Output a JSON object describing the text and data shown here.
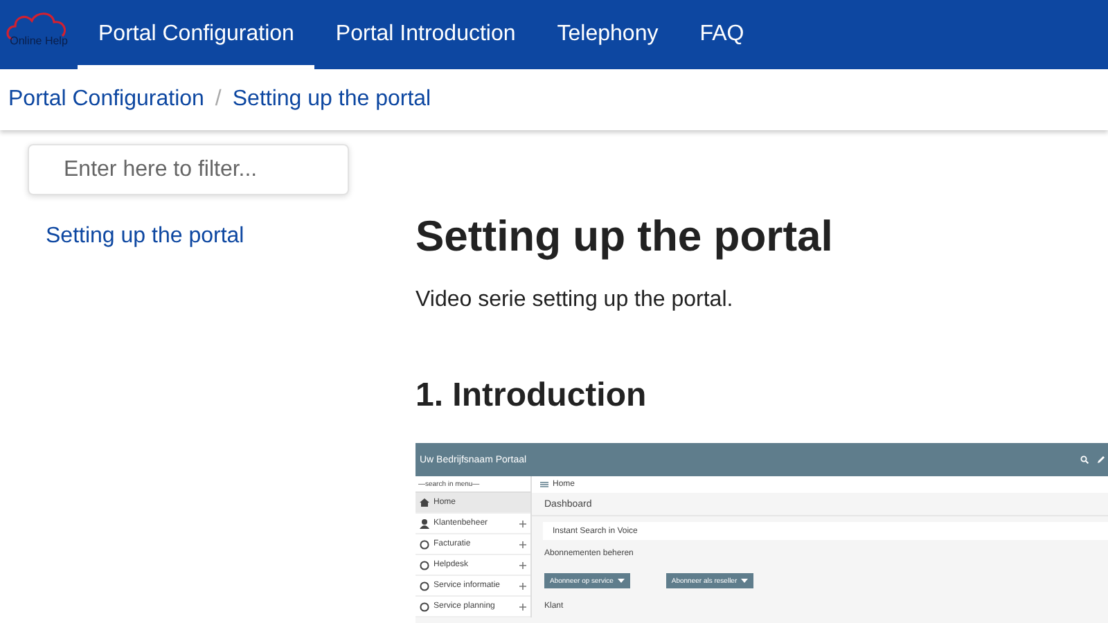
{
  "header": {
    "logo_text": "Online Help",
    "nav": [
      {
        "label": "Portal Configuration",
        "selected": true
      },
      {
        "label": "Portal Introduction",
        "selected": false
      },
      {
        "label": "Telephony",
        "selected": false
      },
      {
        "label": "FAQ",
        "selected": false
      }
    ]
  },
  "breadcrumb": {
    "items": [
      "Portal Configuration",
      "Setting up the portal"
    ],
    "separator": "/"
  },
  "sidebar": {
    "filter": {
      "placeholder": "Enter here to filter..."
    },
    "items": [
      "Setting up the portal"
    ]
  },
  "content": {
    "title": "Setting up the portal",
    "intro": "Video serie setting up the portal.",
    "section_heading": "1. Introduction",
    "screenshot": {
      "title": "Uw Bedrijfsnaam Portaal",
      "menu_search": "—search in menu—",
      "breadcrumb": "Home",
      "panel_title": "Dashboard",
      "search_value": "Instant Search in Voice",
      "section_label": "Abonnementen beheren",
      "buttons": [
        "Abonneer op service",
        "Abonneer als reseller"
      ],
      "label_2": "Klant",
      "menu": [
        {
          "label": "Home",
          "selected": true,
          "expandable": false
        },
        {
          "label": "Klantenbeheer",
          "selected": false,
          "expandable": true
        },
        {
          "label": "Facturatie",
          "selected": false,
          "expandable": true
        },
        {
          "label": "Helpdesk",
          "selected": false,
          "expandable": true
        },
        {
          "label": "Service informatie",
          "selected": false,
          "expandable": true
        },
        {
          "label": "Service planning",
          "selected": false,
          "expandable": true
        }
      ]
    }
  }
}
